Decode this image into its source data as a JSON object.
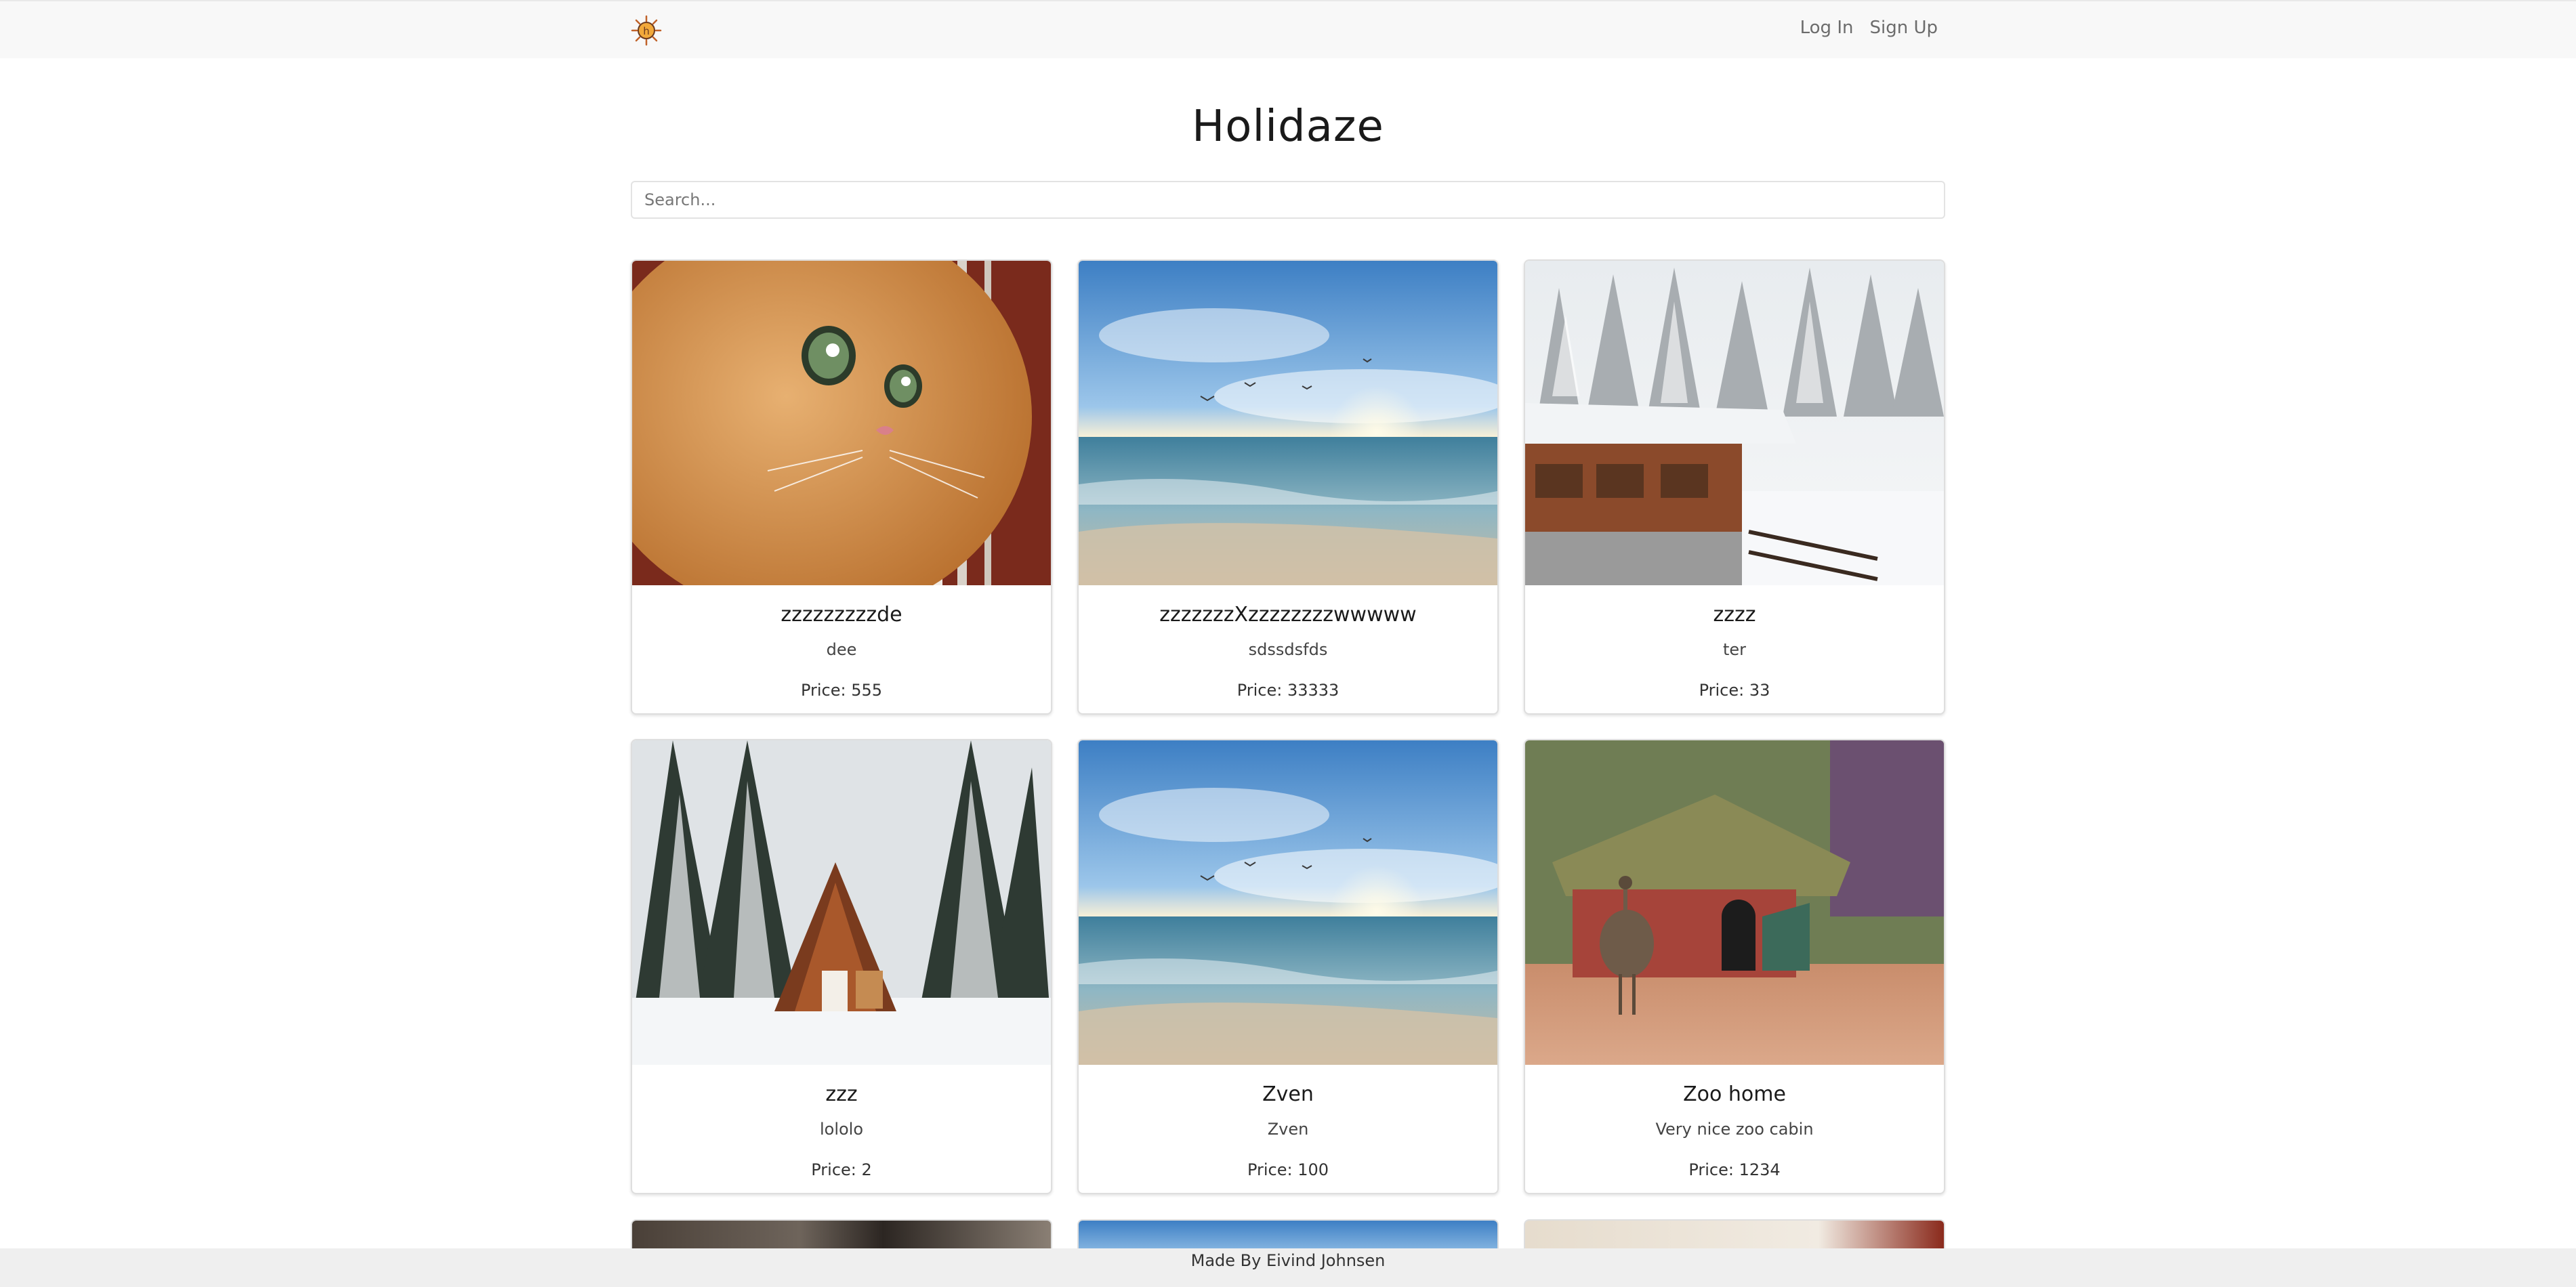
{
  "nav": {
    "logo_icon": "sun-logo-icon",
    "links": [
      "Log In",
      "Sign Up"
    ]
  },
  "page": {
    "title": "Holidaze"
  },
  "search": {
    "placeholder": "Search...",
    "value": ""
  },
  "cards": [
    {
      "title": "zzzzzzzzzde",
      "description": "dee",
      "price": "Price: 555",
      "image": "cat-photo"
    },
    {
      "title": "zzzzzzzXzzzzzzzzwwwww",
      "description": "sdssdsfds",
      "price": "Price: 33333",
      "image": "beach-sunset-photo"
    },
    {
      "title": "zzzz",
      "description": "ter",
      "price": "Price: 33",
      "image": "snowy-cabin-photo"
    },
    {
      "title": "zzz",
      "description": "lololo",
      "price": "Price: 2",
      "image": "a-frame-cabin-photo"
    },
    {
      "title": "Zven",
      "description": "Zven",
      "price": "Price: 100",
      "image": "beach-sunset-photo"
    },
    {
      "title": "Zoo home",
      "description": "Very nice zoo cabin",
      "price": "Price: 1234",
      "image": "emu-hut-photo"
    }
  ],
  "footer": {
    "text": "Made By Eivind Johnsen"
  }
}
